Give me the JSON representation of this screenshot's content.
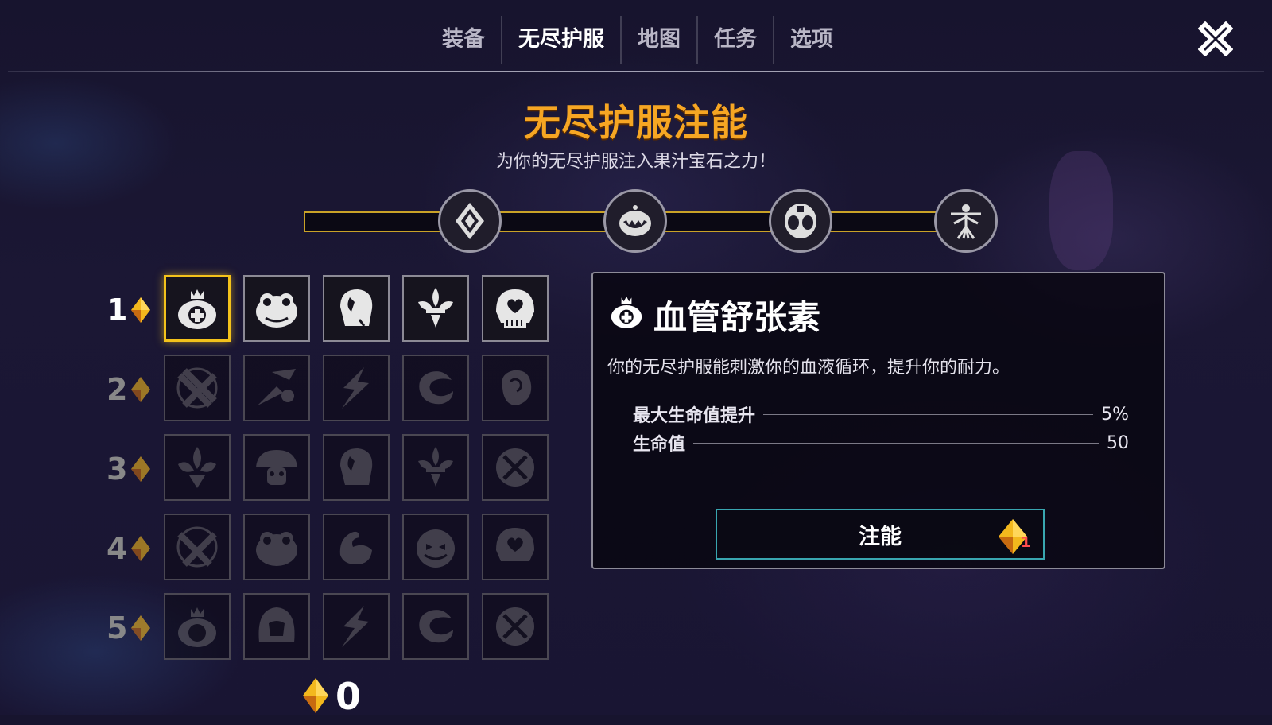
{
  "nav": {
    "tabs": [
      {
        "label": "装备"
      },
      {
        "label": "无尽护服"
      },
      {
        "label": "地图"
      },
      {
        "label": "任务"
      },
      {
        "label": "选项"
      }
    ],
    "active_tab": "无尽护服",
    "close_icon": "close-x-icon"
  },
  "header": {
    "title": "无尽护服注能",
    "subtitle": "为你的无尽护服注入果汁宝石之力！"
  },
  "progress": {
    "nodes": [
      "diamond-gem-icon",
      "grinning-face-icon",
      "alien-face-icon",
      "vitruvian-figure-icon"
    ]
  },
  "grid": {
    "rows": [
      {
        "label": "1",
        "cells": [
          "medic-crown-icon",
          "frog-face-icon",
          "skull-mask-icon",
          "fleur-emblem-icon",
          "heart-helmet-icon"
        ]
      },
      {
        "label": "2",
        "cells": [
          "crossed-utensils-icon",
          "rocket-burst-icon",
          "lightning-claw-icon",
          "swirl-dragon-icon",
          "rose-fist-icon"
        ]
      },
      {
        "label": "3",
        "cells": [
          "fleur-de-lis-icon",
          "mushroom-face-icon",
          "skull-mask-icon",
          "fleur-emblem-icon",
          "crossed-shield-icon"
        ]
      },
      {
        "label": "4",
        "cells": [
          "crossed-utensils-icon",
          "frog-face-icon",
          "flame-swirl-icon",
          "pumpkin-face-icon",
          "heart-helmet-icon"
        ]
      },
      {
        "label": "5",
        "cells": [
          "medic-crown-icon",
          "hooded-face-icon",
          "lightning-claw-icon",
          "swirl-dragon-icon",
          "crossed-shield-icon"
        ]
      }
    ],
    "selected": "1-1"
  },
  "detail": {
    "icon": "medic-crown-icon",
    "title": "血管舒张素",
    "description": "你的无尽护服能刺激你的血液循环，提升你的耐力。",
    "stats": [
      {
        "label": "最大生命值提升",
        "value": "5%"
      },
      {
        "label": "生命值",
        "value": "50"
      }
    ],
    "button_label": "注能",
    "cost": "1"
  },
  "currency": {
    "amount": "0",
    "icon": "juice-gem-icon"
  },
  "colors": {
    "title_orange": "#f6a623",
    "selected_gold": "#f3c21b",
    "button_border": "#39a6b0",
    "cost_red": "#ff4d4d"
  }
}
